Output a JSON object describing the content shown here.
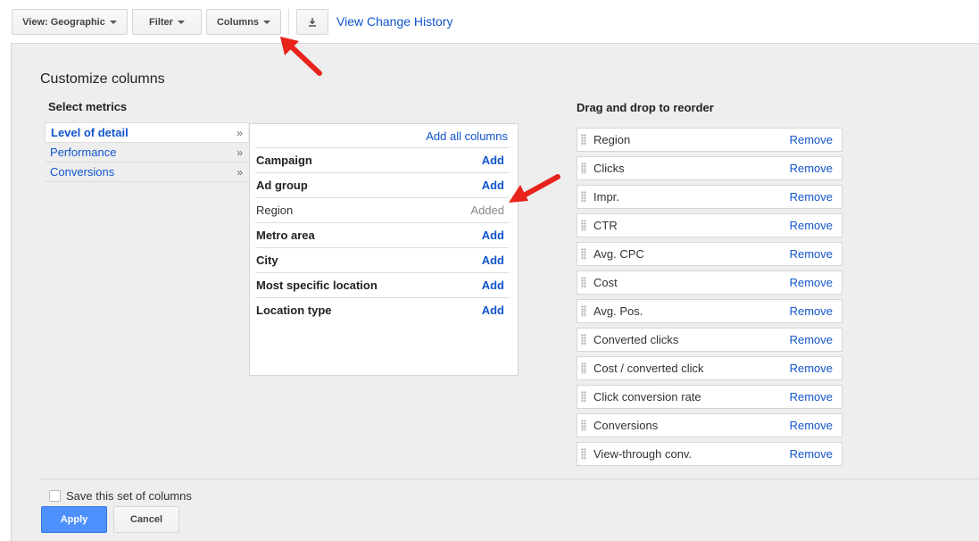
{
  "toolbar": {
    "view_label": "View: Geographic",
    "filter_label": "Filter",
    "columns_label": "Columns",
    "change_history_label": "View Change History"
  },
  "panel": {
    "title": "Customize columns",
    "select_metrics_heading": "Select metrics",
    "reorder_heading": "Drag and drop to reorder",
    "categories": [
      {
        "label": "Level of detail",
        "selected": true
      },
      {
        "label": "Performance",
        "selected": false
      },
      {
        "label": "Conversions",
        "selected": false
      }
    ],
    "add_all_label": "Add all columns",
    "metrics": [
      {
        "name": "Campaign",
        "action": "Add",
        "added": false
      },
      {
        "name": "Ad group",
        "action": "Add",
        "added": false
      },
      {
        "name": "Region",
        "action": "Added",
        "added": true
      },
      {
        "name": "Metro area",
        "action": "Add",
        "added": false
      },
      {
        "name": "City",
        "action": "Add",
        "added": false
      },
      {
        "name": "Most specific location",
        "action": "Add",
        "added": false
      },
      {
        "name": "Location type",
        "action": "Add",
        "added": false
      }
    ],
    "selected_columns": [
      {
        "name": "Region",
        "remove": "Remove"
      },
      {
        "name": "Clicks",
        "remove": "Remove"
      },
      {
        "name": "Impr.",
        "remove": "Remove"
      },
      {
        "name": "CTR",
        "remove": "Remove"
      },
      {
        "name": "Avg. CPC",
        "remove": "Remove"
      },
      {
        "name": "Cost",
        "remove": "Remove"
      },
      {
        "name": "Avg. Pos.",
        "remove": "Remove"
      },
      {
        "name": "Converted clicks",
        "remove": "Remove"
      },
      {
        "name": "Cost / converted click",
        "remove": "Remove"
      },
      {
        "name": "Click conversion rate",
        "remove": "Remove"
      },
      {
        "name": "Conversions",
        "remove": "Remove"
      },
      {
        "name": "View-through conv.",
        "remove": "Remove"
      }
    ],
    "save_set_label": "Save this set of columns",
    "apply_label": "Apply",
    "cancel_label": "Cancel"
  },
  "colors": {
    "link": "#1155cc",
    "apply_bg": "#4d90fe",
    "annotation_arrow": "#e8231b"
  }
}
